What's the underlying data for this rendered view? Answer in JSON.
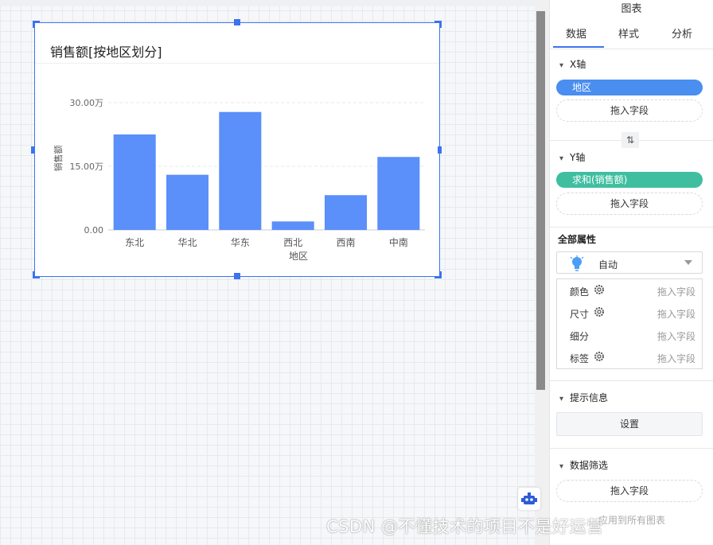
{
  "chart_title": "销售额[按地区划分]",
  "chart_data": {
    "type": "bar",
    "categories": [
      "东北",
      "华北",
      "华东",
      "西北",
      "西南",
      "中南"
    ],
    "values": [
      22.5,
      13.0,
      27.8,
      2.0,
      8.2,
      17.2
    ],
    "xlabel": "地区",
    "ylabel": "销售额",
    "ylim": [
      0,
      30
    ],
    "y_ticks": [
      0,
      15,
      30
    ],
    "y_tick_labels": [
      "0.00",
      "15.00万",
      "30.00万"
    ],
    "grid": true,
    "bar_color": "#5b8ff9"
  },
  "panel": {
    "header": "图表",
    "tabs": [
      {
        "label": "数据",
        "active": true
      },
      {
        "label": "样式",
        "active": false
      },
      {
        "label": "分析",
        "active": false
      }
    ],
    "x_axis": {
      "title": "X轴",
      "field": "地区",
      "field_color": "#4a8ef0",
      "drop": "拖入字段"
    },
    "swap_icon": "swap-vertical-icon",
    "y_axis": {
      "title": "Y轴",
      "field": "求和(销售额)",
      "field_color": "#3fbfa0",
      "drop": "拖入字段"
    },
    "all_props": {
      "title": "全部属性",
      "mark_type": "自动",
      "rows": [
        {
          "name": "颜色",
          "hint": "拖入字段",
          "gear": true
        },
        {
          "name": "尺寸",
          "hint": "拖入字段",
          "gear": true
        },
        {
          "name": "细分",
          "hint": "拖入字段",
          "gear": false
        },
        {
          "name": "标签",
          "hint": "拖入字段",
          "gear": true
        }
      ]
    },
    "tooltip": {
      "title": "提示信息",
      "button": "设置"
    },
    "filter": {
      "title": "数据筛选",
      "drop": "拖入字段",
      "footer": "应用到所有图表"
    }
  },
  "watermark": "CSDN @不懂技术的项目不是好运营"
}
